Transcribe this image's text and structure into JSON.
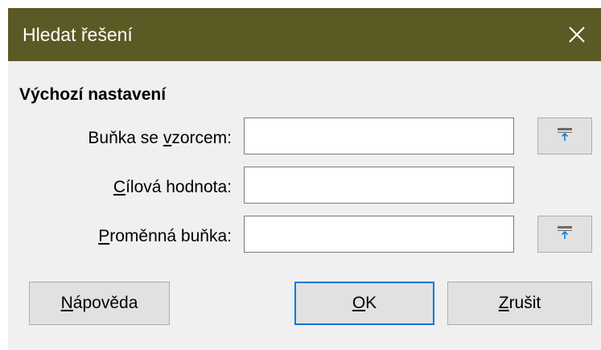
{
  "dialog": {
    "title": "Hledat řešení",
    "section_title": "Výchozí nastavení"
  },
  "fields": [
    {
      "label_pre": "Buňka se ",
      "label_mnemonic": "v",
      "label_post": "zorcem:",
      "value": "",
      "has_shrink_button": true
    },
    {
      "label_pre": "",
      "label_mnemonic": "C",
      "label_post": "ílová hodnota:",
      "value": "",
      "has_shrink_button": false
    },
    {
      "label_pre": "",
      "label_mnemonic": "P",
      "label_post": "roměnná buňka:",
      "value": "",
      "has_shrink_button": true
    }
  ],
  "buttons": {
    "help": {
      "mnemonic": "N",
      "rest": "ápověda"
    },
    "ok": {
      "mnemonic": "O",
      "rest": "K"
    },
    "cancel": {
      "mnemonic": "Z",
      "rest": "rušit"
    }
  },
  "icons": {
    "close": "close-icon",
    "shrink": "shrink-icon"
  },
  "colors": {
    "titlebar": "#5b5924",
    "title_text": "#ffffff",
    "dialog_bg": "#f0f0f0",
    "default_button_border": "#0078d7",
    "shrink_arrow": "#0078d7"
  }
}
